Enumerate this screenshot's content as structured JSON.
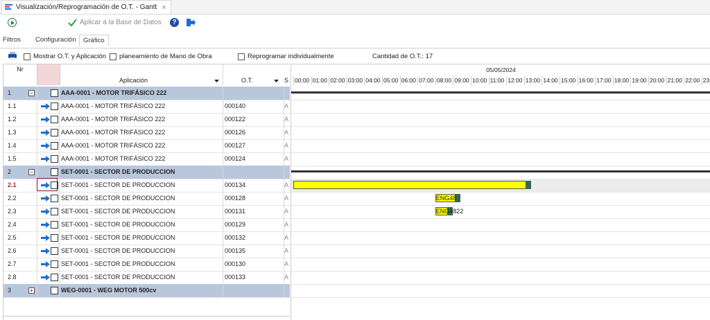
{
  "window": {
    "title": "Visualización/Reprogramación de O.T. - Gantt",
    "close": "×"
  },
  "toolbar": {
    "apply_label": "Aplicar a la Base de Datos"
  },
  "tabs": [
    {
      "label": "Filtros"
    },
    {
      "label": "Configuración"
    },
    {
      "label": "Gráfico"
    }
  ],
  "options": {
    "show_ot": "Mostrar O.T. y Aplicación",
    "labor_planning": "planeamiento de Mano de Obra",
    "reschedule": "Reprogramar individualmente",
    "count_label": "Cantidad de O.T.: 17"
  },
  "grid": {
    "headers": {
      "nr": "Nr",
      "aplicacion": "Aplicación",
      "ot": "O.T.",
      "extra": "S"
    },
    "rows": [
      {
        "nr": "1",
        "aplicacion": "AAA-0001 - MOTOR TRIFÁSICO 222",
        "ot": "",
        "group": true,
        "toggle": "−"
      },
      {
        "nr": "1.1",
        "aplicacion": "AAA-0001 - MOTOR TRIFÁSICO 222",
        "ot": "000140",
        "extra": "A"
      },
      {
        "nr": "1.2",
        "aplicacion": "AAA-0001 - MOTOR TRIFÁSICO 222",
        "ot": "000122",
        "extra": "A"
      },
      {
        "nr": "1.3",
        "aplicacion": "AAA-0001 - MOTOR TRIFÁSICO 222",
        "ot": "000126",
        "extra": "A"
      },
      {
        "nr": "1.4",
        "aplicacion": "AAA-0001 - MOTOR TRIFÁSICO 222",
        "ot": "000127",
        "extra": "A"
      },
      {
        "nr": "1.5",
        "aplicacion": "AAA-0001 - MOTOR TRIFÁSICO 222",
        "ot": "000124",
        "extra": "A"
      },
      {
        "nr": "2",
        "aplicacion": "SET-0001 - SECTOR DE PRODUCCION",
        "ot": "",
        "group": true,
        "toggle": "−"
      },
      {
        "nr": "2.1",
        "aplicacion": "SET-0001 - SECTOR DE PRODUCCION",
        "ot": "000134",
        "extra": "A",
        "selected": true
      },
      {
        "nr": "2.2",
        "aplicacion": "SET-0001 - SECTOR DE PRODUCCION",
        "ot": "000128",
        "extra": "A"
      },
      {
        "nr": "2.3",
        "aplicacion": "SET-0001 - SECTOR DE PRODUCCION",
        "ot": "000131",
        "extra": "A"
      },
      {
        "nr": "2.4",
        "aplicacion": "SET-0001 - SECTOR DE PRODUCCION",
        "ot": "000129",
        "extra": "A"
      },
      {
        "nr": "2.5",
        "aplicacion": "SET-0001 - SECTOR DE PRODUCCION",
        "ot": "000132",
        "extra": "A"
      },
      {
        "nr": "2.6",
        "aplicacion": "SET-0001 - SECTOR DE PRODUCCION",
        "ot": "000135",
        "extra": "A"
      },
      {
        "nr": "2.7",
        "aplicacion": "SET-0001 - SECTOR DE PRODUCCION",
        "ot": "000130",
        "extra": "A"
      },
      {
        "nr": "2.8",
        "aplicacion": "SET-0001 - SECTOR DE PRODUCCION",
        "ot": "000133",
        "extra": "A"
      },
      {
        "nr": "3",
        "aplicacion": "WEG-0001 - WEG MOTOR 500cv",
        "ot": "",
        "group": true,
        "toggle": "+"
      }
    ]
  },
  "gantt": {
    "date": "05/05/2024",
    "hours": [
      "00:00",
      "01:00",
      "02:00",
      "03:00",
      "04:00",
      "05:00",
      "06:00",
      "07:00",
      "08:00",
      "09:00",
      "10:00",
      "11:00",
      "12:00",
      "13:00",
      "14:00",
      "15:00",
      "16:00",
      "17:00",
      "18:00",
      "19:00",
      "20:00",
      "21:00",
      "22:00",
      "23:"
    ],
    "bars": [
      {
        "row": 7,
        "start_hour": 0.0,
        "end_hour": 13.4,
        "label": ""
      },
      {
        "row": 8,
        "start_hour": 8.0,
        "end_hour": 9.4,
        "label": "ENG48"
      },
      {
        "row": 9,
        "start_hour": 8.0,
        "end_hour": 9.0,
        "label": "ENG4822"
      }
    ],
    "summary_rows": [
      0,
      6
    ]
  },
  "colors": {
    "group_row": "#b9c7dc",
    "bar": "#ffff00",
    "accent": "#1f6fd1",
    "ok_green": "#3aa53a"
  }
}
